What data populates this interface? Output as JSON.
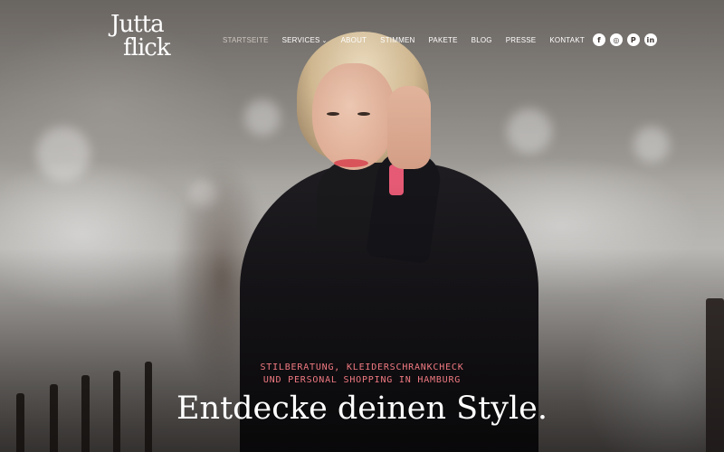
{
  "header": {
    "logo_line1": "Jutta",
    "logo_line2": "flick"
  },
  "nav": {
    "items": [
      {
        "label": "STARTSEITE",
        "active": true
      },
      {
        "label": "SERVICES",
        "has_dropdown": true
      },
      {
        "label": "ABOUT"
      },
      {
        "label": "STIMMEN"
      },
      {
        "label": "PAKETE"
      },
      {
        "label": "BLOG"
      },
      {
        "label": "PRESSE"
      },
      {
        "label": "KONTAKT"
      }
    ],
    "social": [
      {
        "icon": "facebook-icon",
        "glyph": "f"
      },
      {
        "icon": "instagram-icon",
        "glyph": "◎"
      },
      {
        "icon": "pinterest-icon",
        "glyph": "P"
      },
      {
        "icon": "linkedin-icon",
        "glyph": "in"
      }
    ]
  },
  "hero": {
    "tagline_line1": "STILBERATUNG, KLEIDERSCHRANKCHECK",
    "tagline_line2": "UND PERSONAL SHOPPING IN HAMBURG",
    "headline": "Entdecke deinen Style."
  },
  "colors": {
    "accent": "#f07a82",
    "text": "#ffffff"
  }
}
